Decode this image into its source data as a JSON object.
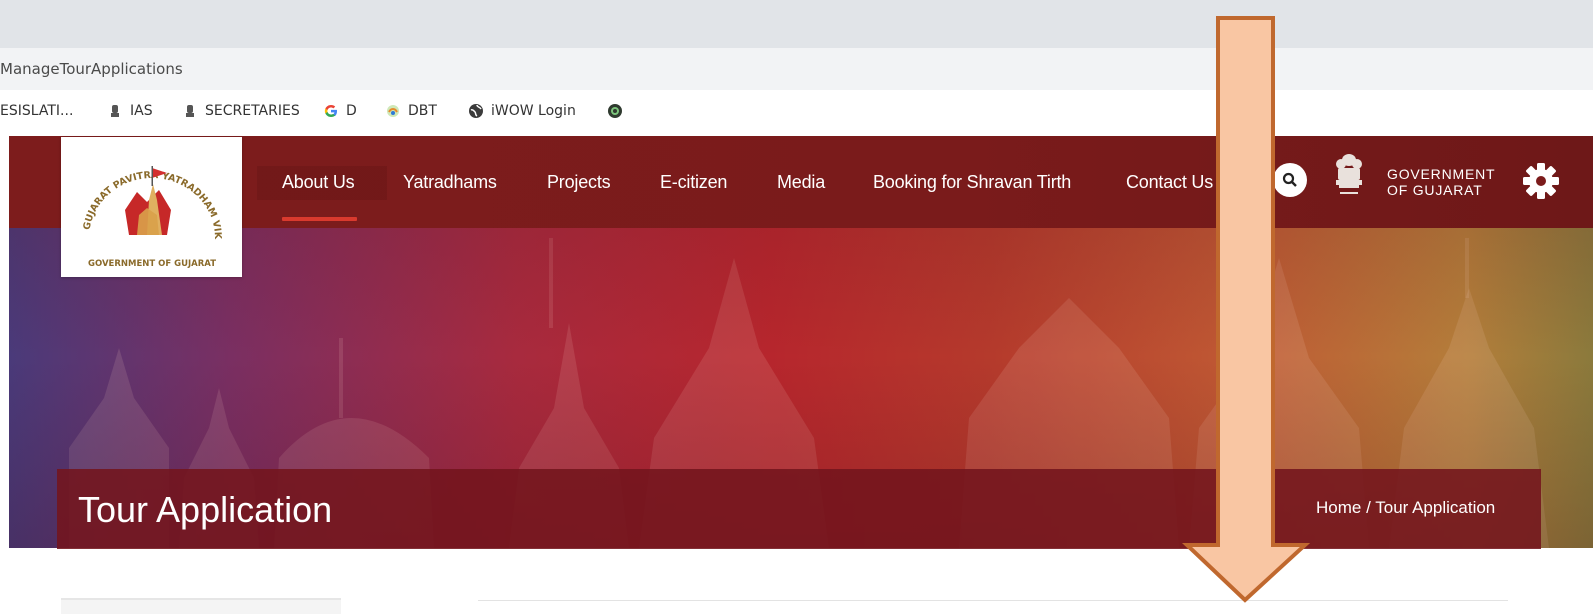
{
  "browser": {
    "url": "ManageTourApplications",
    "bookmarks": [
      {
        "label": "ESISLATI...",
        "icon": "none"
      },
      {
        "label": "IAS",
        "icon": "emblem-icon"
      },
      {
        "label": "SECRETARIES",
        "icon": "emblem-icon"
      },
      {
        "label": "D",
        "icon": "google-icon"
      },
      {
        "label": "DBT",
        "icon": "dbt-icon"
      },
      {
        "label": "iWOW Login",
        "icon": "globe-icon"
      },
      {
        "label": "",
        "icon": "app-icon"
      }
    ]
  },
  "site": {
    "logo": {
      "arc_text": "GUJARAT PAVITRA YATRADHAM VIKAS BOARD",
      "bottom_text": "GOVERNMENT OF GUJARAT"
    },
    "nav": [
      {
        "label": "About Us",
        "active": true
      },
      {
        "label": "Yatradhams"
      },
      {
        "label": "Projects"
      },
      {
        "label": "E-citizen"
      },
      {
        "label": "Media"
      },
      {
        "label": "Booking for Shravan Tirth"
      },
      {
        "label": "Contact Us"
      }
    ],
    "gov_label": "GOVERNMENT\nOF GUJARAT",
    "icons": {
      "search": "search-icon",
      "emblem": "national-emblem-icon",
      "settings": "gear-icon"
    }
  },
  "banner": {
    "title": "Tour Application",
    "breadcrumb_home": "Home",
    "breadcrumb_sep": " / ",
    "breadcrumb_current": "Tour Application"
  },
  "colors": {
    "navbar": "#7d1c1c",
    "active_underline": "#d93a2e",
    "arrow_fill": "#f9c6a3",
    "arrow_stroke": "#c0682e"
  }
}
